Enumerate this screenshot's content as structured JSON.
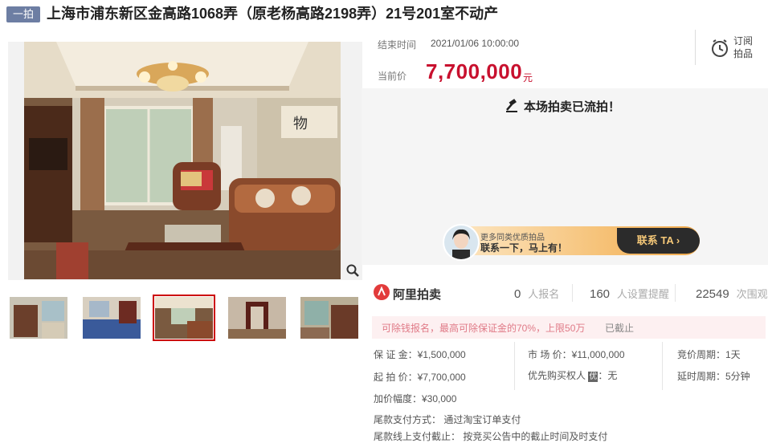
{
  "header": {
    "badge": "一拍",
    "title": "上海市浦东新区金高路1068弄（原老杨高路2198弄）21号201室不动产"
  },
  "auction": {
    "end_time_label": "结束时间",
    "end_time": "2021/01/06 10:00:00",
    "price_label": "当前价",
    "price": "7,700,000",
    "price_unit": "元",
    "subscribe_line1": "订阅",
    "subscribe_line2": "拍品",
    "status": "本场拍卖已流拍！"
  },
  "banner": {
    "small": "更多同类优质拍品",
    "big": "联系一下，马上有！",
    "button": "联系 TA"
  },
  "brand": "阿里拍卖",
  "stats": [
    {
      "num": "0",
      "label": "人报名"
    },
    {
      "num": "160",
      "label": "人设置提醒"
    },
    {
      "num": "22549",
      "label": "次围观"
    }
  ],
  "notice": {
    "text": "可除钱报名，最高可除保证金的70%，上限50万",
    "status": "已截止"
  },
  "details": {
    "deposit": "保 证 金：¥1,500,000",
    "market": "市 场 价：¥11,000,000",
    "cycle": "竞价周期：1天",
    "start": "起 拍 价：¥7,700,000",
    "priority": "优先购买权人",
    "priority_icon": "优",
    "priority_value": "：无",
    "delay": "延时周期：5分钟",
    "increment": "加价幅度：¥30,000",
    "pay_method": "尾款支付方式：  通过淘宝订单支付",
    "pay_deadline": "尾款线上支付截止：  按竞买公告中的截止时间及时支付"
  },
  "colors": {
    "accent": "#c8102e",
    "badge": "#6d7ea3",
    "pink_bg": "#fdf0f1"
  }
}
